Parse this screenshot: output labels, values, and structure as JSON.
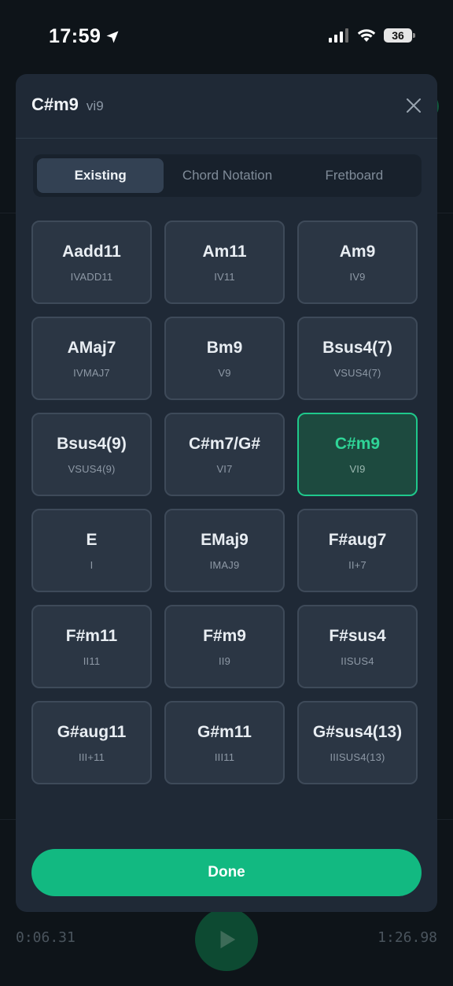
{
  "status_bar": {
    "time": "17:59",
    "battery": "36"
  },
  "modal": {
    "title": "C#m9",
    "roman": "vi9",
    "tabs": [
      {
        "label": "Existing",
        "active": true
      },
      {
        "label": "Chord Notation",
        "active": false
      },
      {
        "label": "Fretboard",
        "active": false
      }
    ],
    "chords": [
      {
        "name": "Aadd11",
        "roman": "IVADD11"
      },
      {
        "name": "Am11",
        "roman": "IV11"
      },
      {
        "name": "Am9",
        "roman": "IV9"
      },
      {
        "name": "AMaj7",
        "roman": "IVMAJ7"
      },
      {
        "name": "Bm9",
        "roman": "V9"
      },
      {
        "name": "Bsus4(7)",
        "roman": "VSUS4(7)"
      },
      {
        "name": "Bsus4(9)",
        "roman": "VSUS4(9)"
      },
      {
        "name": "C#m7/G#",
        "roman": "VI7"
      },
      {
        "name": "C#m9",
        "roman": "VI9",
        "selected": true
      },
      {
        "name": "E",
        "roman": "I"
      },
      {
        "name": "EMaj9",
        "roman": "IMAJ9"
      },
      {
        "name": "F#aug7",
        "roman": "II+7"
      },
      {
        "name": "F#m11",
        "roman": "II11"
      },
      {
        "name": "F#m9",
        "roman": "II9"
      },
      {
        "name": "F#sus4",
        "roman": "IISUS4"
      },
      {
        "name": "G#aug11",
        "roman": "III+11"
      },
      {
        "name": "G#m11",
        "roman": "III11"
      },
      {
        "name": "G#sus4(13)",
        "roman": "IIISUS4(13)"
      }
    ],
    "done_label": "Done"
  },
  "player": {
    "current_time": "0:06.31",
    "total_time": "1:26.98"
  },
  "colors": {
    "accent": "#12b981",
    "selected_bg": "#1d4a3f",
    "modal_bg": "#1f2936"
  }
}
